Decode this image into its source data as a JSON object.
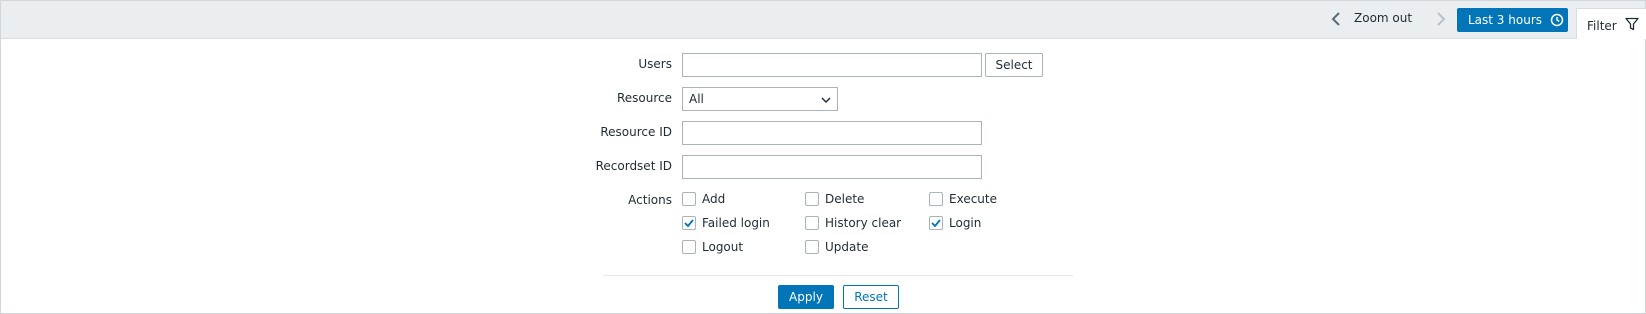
{
  "toolbar": {
    "zoom_out_label": "Zoom out",
    "period_label": "Last 3 hours",
    "filter_tab_label": "Filter"
  },
  "form": {
    "users_label": "Users",
    "users_value": "",
    "select_button": "Select",
    "resource_label": "Resource",
    "resource_selected": "All",
    "resource_id_label": "Resource ID",
    "resource_id_value": "",
    "recordset_id_label": "Recordset ID",
    "recordset_id_value": "",
    "actions_label": "Actions",
    "actions": [
      {
        "label": "Add",
        "checked": false
      },
      {
        "label": "Delete",
        "checked": false
      },
      {
        "label": "Execute",
        "checked": false
      },
      {
        "label": "Failed login",
        "checked": true
      },
      {
        "label": "History clear",
        "checked": false
      },
      {
        "label": "Login",
        "checked": true
      },
      {
        "label": "Logout",
        "checked": false
      },
      {
        "label": "Update",
        "checked": false
      }
    ],
    "apply_button": "Apply",
    "reset_button": "Reset"
  },
  "colors": {
    "accent": "#0275b8",
    "toolbar_bg": "#ebeef0",
    "border": "#a8b3ba"
  },
  "icons": {
    "prev": "chevron-left-icon",
    "next": "chevron-right-icon",
    "clock": "clock-icon",
    "filter": "filter-icon",
    "dropdown": "chevron-down-icon",
    "check": "checkmark-icon"
  }
}
